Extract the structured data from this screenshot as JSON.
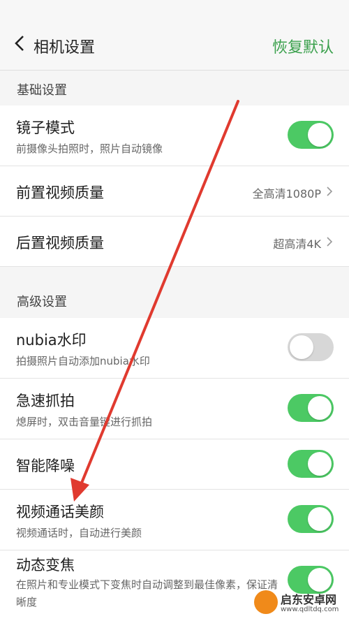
{
  "header": {
    "title": "相机设置",
    "reset_label": "恢复默认"
  },
  "sections": [
    {
      "label": "基础设置"
    },
    {
      "label": "高级设置"
    }
  ],
  "rows": [
    {
      "title": "镜子模式",
      "subtitle": "前摄像头拍照时，照片自动镜像",
      "toggle": "on"
    },
    {
      "title": "前置视频质量",
      "value": "全高清1080P"
    },
    {
      "title": "后置视频质量",
      "value": "超高清4K"
    },
    {
      "title": "nubia水印",
      "subtitle": "拍摄照片自动添加nubia水印",
      "toggle": "off"
    },
    {
      "title": "急速抓拍",
      "subtitle": "熄屏时，双击音量键进行抓拍",
      "toggle": "on"
    },
    {
      "title": "智能降噪",
      "toggle": "on"
    },
    {
      "title": "视频通话美颜",
      "subtitle": "视频通话时，自动进行美颜",
      "toggle": "on"
    },
    {
      "title": "动态变焦",
      "subtitle": "在照片和专业模式下变焦时自动调整到最佳像素，保证清晰度",
      "toggle": "on"
    }
  ],
  "watermark": {
    "text": "启东安卓网",
    "url": "www.qdltdq.com"
  },
  "colors": {
    "accent": "#3aa04c",
    "toggle_on": "#4cc964",
    "toggle_off": "#d7d7d7",
    "arrow": "#e03a2f"
  }
}
